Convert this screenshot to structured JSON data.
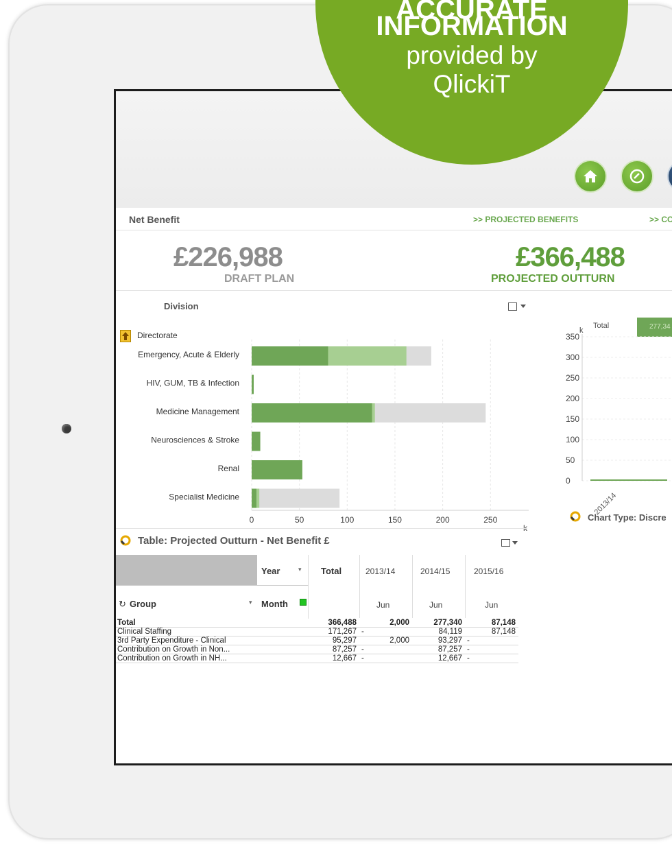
{
  "badge": {
    "line1": "ACCURATE",
    "line2": "INFORMATION",
    "line3": "provided by",
    "line4": "QlickiT",
    "color": "#77aa24"
  },
  "nav": {
    "icons": [
      "home-icon",
      "dashboard-gauge-icon",
      "report-icon"
    ]
  },
  "header": {
    "title": "Net Benefit",
    "link_projected": ">> PROJECTED BENEFITS",
    "link_co": ">> CO"
  },
  "kpis": {
    "draft_value": "£226,988",
    "draft_label": "DRAFT PLAN",
    "projected_value": "£366,488",
    "projected_label": "PROJECTED OUTTURN"
  },
  "division_chart": {
    "title": "Division",
    "dimension_label": "Directorate",
    "unit": "k"
  },
  "chart_data": [
    {
      "type": "bar",
      "orientation": "horizontal",
      "title": "Division",
      "categories": [
        "Emergency, Acute & Elderly",
        "HIV, GUM, TB & Infection",
        "Medicine Management",
        "Neurosciences & Stroke",
        "Renal",
        "Specialist Medicine"
      ],
      "series": [
        {
          "values": [
            80,
            2,
            126,
            9,
            53,
            5
          ],
          "color": "#6fa657"
        },
        {
          "values": [
            162,
            2,
            129,
            9,
            53,
            8
          ],
          "color": "#a7cf92"
        },
        {
          "values": [
            188,
            2,
            245,
            9,
            53,
            92
          ],
          "color": "#dcdcdc"
        }
      ],
      "xticks": [
        0,
        50,
        100,
        150,
        200,
        250
      ],
      "xlim": [
        0,
        290
      ],
      "xunit": "k",
      "grid": true
    },
    {
      "type": "bar",
      "title": "",
      "legend": [
        "Total",
        "277,34"
      ],
      "categories": [
        "2013/14"
      ],
      "values": [
        2
      ],
      "yticks": [
        0,
        50,
        100,
        150,
        200,
        250,
        300,
        350
      ],
      "ylim": [
        0,
        350
      ],
      "yunit": "k",
      "grid": true
    }
  ],
  "right_chart": {
    "legend_total": "Total",
    "legend_value": "277,34",
    "unit": "k",
    "x_label": "2013/14",
    "chart_type_label": "Chart Type: Discre"
  },
  "table": {
    "title": "Table: Projected Outturn - Net Benefit £",
    "year_label": "Year",
    "month_label": "Month",
    "group_label": "Group",
    "total_header": "Total",
    "years": [
      "2013/14",
      "2014/15",
      "2015/16"
    ],
    "months": [
      "Jun",
      "Jun",
      "Jun"
    ],
    "rows": [
      {
        "label": "Total",
        "total": "366,488",
        "c1": "2,000",
        "c2": "277,340",
        "c3": "87,148",
        "bold": true
      },
      {
        "label": "Clinical Staffing",
        "total": "171,267",
        "c1": "-",
        "c2": "84,119",
        "c3": "87,148",
        "bold": false
      },
      {
        "label": "3rd Party Expenditure - Clinical",
        "total": "95,297",
        "c1": "2,000",
        "c2": "93,297",
        "c3": "-",
        "bold": false
      },
      {
        "label": "Contribution on Growth in Non...",
        "total": "87,257",
        "c1": "-",
        "c2": "87,257",
        "c3": "-",
        "bold": false
      },
      {
        "label": "Contribution on Growth in NH...",
        "total": "12,667",
        "c1": "-",
        "c2": "12,667",
        "c3": "-",
        "bold": false
      }
    ]
  }
}
